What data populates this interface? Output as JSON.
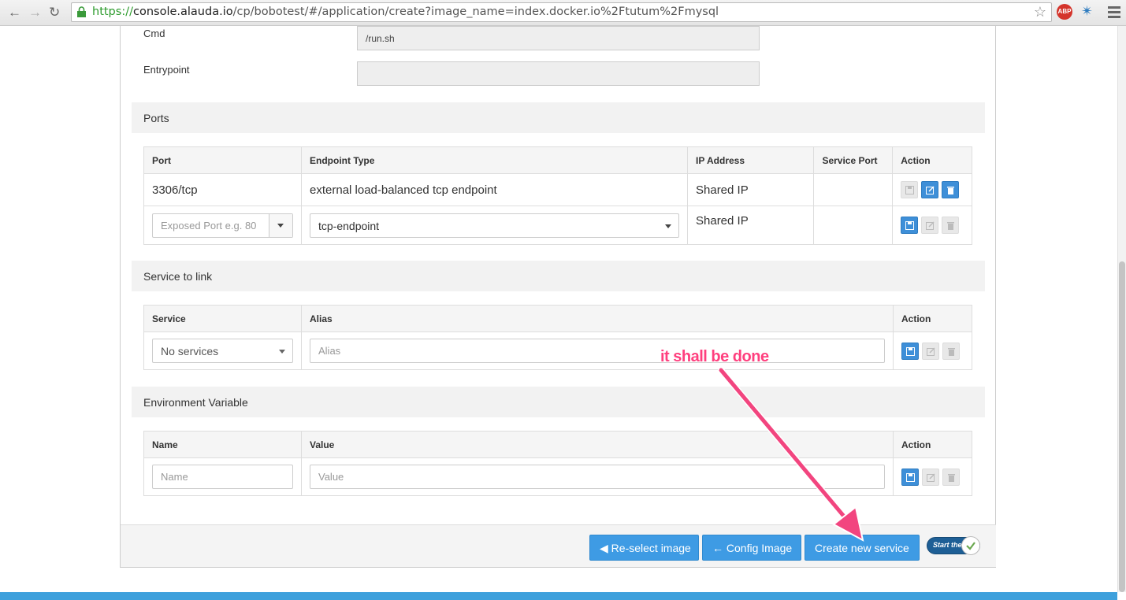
{
  "browser": {
    "url_scheme": "https://",
    "url_host": "console.alauda.io",
    "url_path": "/cp/bobotest/#/application/create?image_name=index.docker.io%2Ftutum%2Fmysql",
    "abp_badge": "ABP"
  },
  "config": {
    "cmd_label": "Cmd",
    "cmd_value": "/run.sh",
    "entrypoint_label": "Entrypoint",
    "entrypoint_value": ""
  },
  "ports": {
    "section_title": "Ports",
    "headers": [
      "Port",
      "Endpoint Type",
      "IP Address",
      "Service Port",
      "Action"
    ],
    "rows": [
      {
        "port": "3306/tcp",
        "endpoint_type": "external load-balanced tcp endpoint",
        "ip": "Shared IP",
        "service_port": ""
      }
    ],
    "new_row": {
      "port_placeholder": "Exposed Port e.g. 80",
      "endpoint_selected": "tcp-endpoint",
      "ip": "Shared IP"
    }
  },
  "links": {
    "section_title": "Service to link",
    "headers": [
      "Service",
      "Alias",
      "Action"
    ],
    "service_selected": "No services",
    "alias_placeholder": "Alias"
  },
  "env": {
    "section_title": "Environment Variable",
    "headers": [
      "Name",
      "Value",
      "Action"
    ],
    "name_placeholder": "Name",
    "value_placeholder": "Value"
  },
  "footer": {
    "reselect_label": "Re-select image",
    "config_label": "Config Image",
    "create_label": "Create new service",
    "toggle_label": "Start the"
  },
  "annotation": {
    "text": "it shall be done",
    "color": "#ff3f7e"
  },
  "colors": {
    "primary_button": "#3e9be4",
    "footer_band": "#3ea0dc"
  }
}
